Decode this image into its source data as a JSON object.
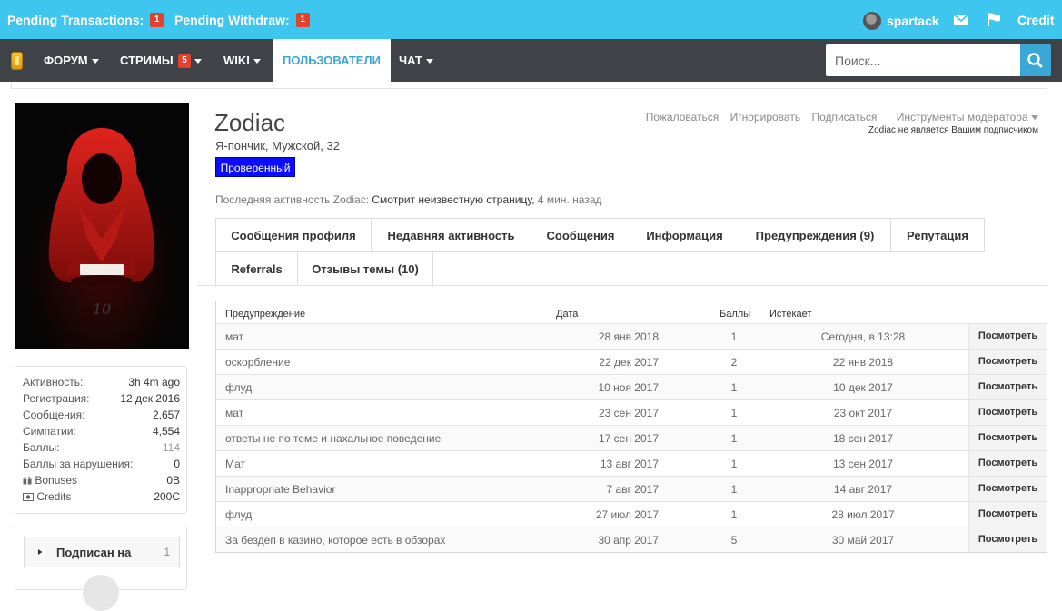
{
  "topbar": {
    "pending_transactions_label": "Pending Transactions:",
    "pending_transactions_count": "1",
    "pending_withdraw_label": "Pending Withdraw:",
    "pending_withdraw_count": "1",
    "username": "spartack",
    "credit_label": "Credit",
    "icons": [
      "avatar",
      "mail-icon",
      "flag-icon"
    ],
    "background_color": "#3ec6ef"
  },
  "nav": {
    "logo_icon": "logo-icon",
    "items": [
      {
        "label": "ФОРУМ",
        "dropdown": true
      },
      {
        "label": "СТРИМЫ",
        "badge": "5",
        "dropdown": true
      },
      {
        "label": "WIKI",
        "dropdown": true
      },
      {
        "label": "ПОЛЬЗОВАТЕЛИ",
        "active": true
      },
      {
        "label": "ЧАТ",
        "dropdown": true
      }
    ],
    "search_placeholder": "Поиск...",
    "search_icon": "search-icon",
    "background_color": "#3f4347",
    "accent_color": "#3aa7d6"
  },
  "profile": {
    "name": "Zodiac",
    "subtitle": "Я-пончик, Мужской, 32",
    "verified_label": "Проверенный",
    "actions": [
      "Пожаловаться",
      "Игнорировать",
      "Подписаться",
      "Инструменты модератора"
    ],
    "follow_note": "Zodiac не является Вашим подписчиком",
    "last_activity_prefix": "Последняя активность Zodiac:",
    "last_activity_value": "Смотрит неизвестную страницу,",
    "last_activity_time": "4 мин. назад"
  },
  "stats": [
    {
      "label": "Активность:",
      "value": "3h 4m ago"
    },
    {
      "label": "Регистрация:",
      "value": "12 дек 2016"
    },
    {
      "label": "Сообщения:",
      "value": "2,657"
    },
    {
      "label": "Симпатии:",
      "value": "4,554"
    },
    {
      "label": "Баллы:",
      "value": "114"
    },
    {
      "label": "Баллы за нарушения:",
      "value": "0"
    },
    {
      "label": "Bonuses",
      "value": "0B"
    },
    {
      "label": "Credits",
      "value": "200C"
    }
  ],
  "following": {
    "label": "Подписан на",
    "count": "1"
  },
  "tabs": [
    {
      "label": "Сообщения профиля"
    },
    {
      "label": "Недавняя активность"
    },
    {
      "label": "Сообщения"
    },
    {
      "label": "Информация"
    },
    {
      "label": "Предупреждения (9)",
      "active": true
    },
    {
      "label": "Репутация"
    },
    {
      "label": "Referrals"
    },
    {
      "label": "Отзывы темы (10)"
    }
  ],
  "warnings": {
    "headers": [
      "Предупреждение",
      "Дата",
      "Баллы",
      "Истекает"
    ],
    "view_label": "Посмотреть",
    "rows": [
      {
        "title": "мат",
        "date": "28 янв 2018",
        "points": "1",
        "expires": "Сегодня, в 13:28"
      },
      {
        "title": "оскорбление",
        "date": "22 дек 2017",
        "points": "2",
        "expires": "22 янв 2018"
      },
      {
        "title": "флуд",
        "date": "10 ноя 2017",
        "points": "1",
        "expires": "10 дек 2017"
      },
      {
        "title": "мат",
        "date": "23 сен 2017",
        "points": "1",
        "expires": "23 окт 2017"
      },
      {
        "title": "ответы не по теме и нахальное поведение",
        "date": "17 сен 2017",
        "points": "1",
        "expires": "18 сен 2017"
      },
      {
        "title": "Мат",
        "date": "13 авг 2017",
        "points": "1",
        "expires": "13 сен 2017"
      },
      {
        "title": "Inappropriate Behavior",
        "date": "7 авг 2017",
        "points": "1",
        "expires": "14 авг 2017"
      },
      {
        "title": "флуд",
        "date": "27 июл 2017",
        "points": "1",
        "expires": "28 июл 2017"
      },
      {
        "title": "За бездеп в казино, которое есть в обзорах",
        "date": "30 апр 2017",
        "points": "5",
        "expires": "30 май 2017"
      }
    ]
  }
}
